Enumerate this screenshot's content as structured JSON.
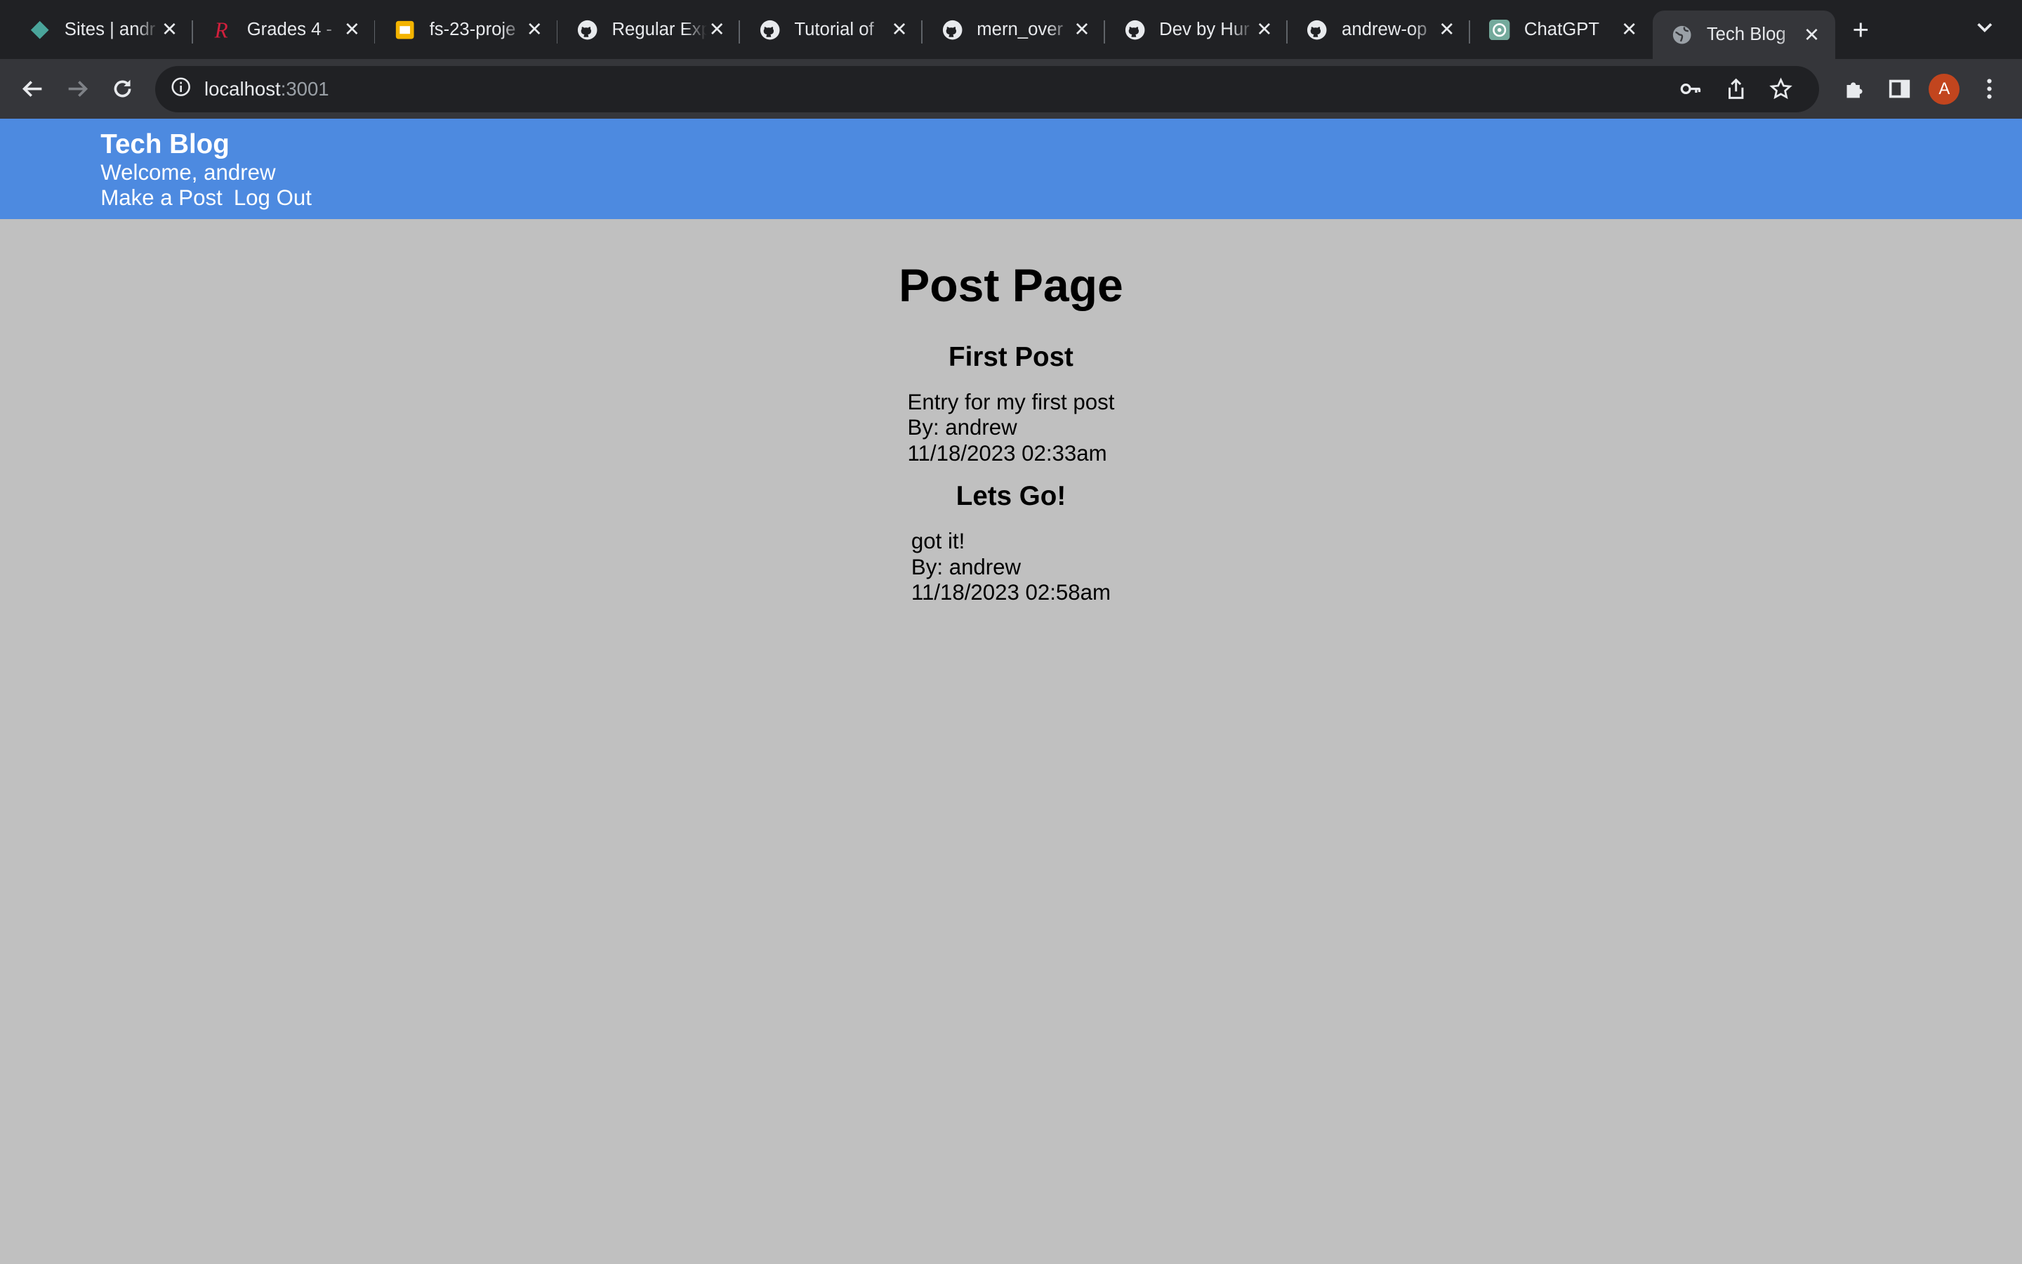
{
  "browser": {
    "tabs": [
      {
        "title": "Sites | andr",
        "icon": "sites-diamond-icon"
      },
      {
        "title": "Grades 4 -",
        "icon": "rutgers-r-icon"
      },
      {
        "title": "fs-23-proje",
        "icon": "slides-icon"
      },
      {
        "title": "Regular Exp",
        "icon": "github-icon"
      },
      {
        "title": "Tutorial of",
        "icon": "github-icon"
      },
      {
        "title": "mern_over",
        "icon": "github-icon"
      },
      {
        "title": "Dev by Hur",
        "icon": "github-icon"
      },
      {
        "title": "andrew-op",
        "icon": "github-icon"
      },
      {
        "title": "ChatGPT",
        "icon": "chatgpt-icon"
      },
      {
        "title": "Tech Blog",
        "icon": "globe-icon",
        "active": true
      }
    ],
    "close_glyph": "✕",
    "new_tab_glyph": "+",
    "url_host": "localhost",
    "url_port": ":3001",
    "profile_initial": "A",
    "colors": {
      "tabstrip": "#202124",
      "toolbar": "#35363a",
      "avatar": "#c2451e"
    }
  },
  "header": {
    "site_title": "Tech Blog",
    "welcome": "Welcome, andrew",
    "nav": {
      "make_post": "Make a Post",
      "logout": "Log Out"
    },
    "color": "#4d8ae0"
  },
  "main": {
    "page_title": "Post Page",
    "posts": [
      {
        "title": "First Post",
        "content": "Entry for my first post",
        "author": "By: andrew",
        "date": "11/18/2023 02:33am"
      },
      {
        "title": "Lets Go!",
        "content": "got it!",
        "author": "By: andrew",
        "date": "11/18/2023 02:58am"
      }
    ],
    "background": "#c0c0c0"
  }
}
